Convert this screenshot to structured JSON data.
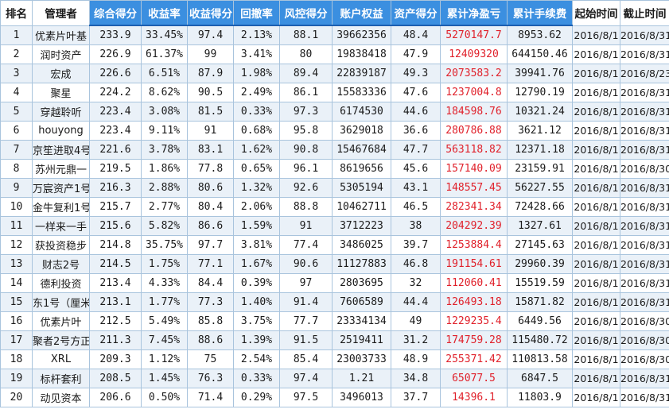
{
  "columns": [
    {
      "label": "排名",
      "sortable": false
    },
    {
      "label": "管理者",
      "sortable": false
    },
    {
      "label": "综合得分",
      "sortable": true
    },
    {
      "label": "收益率",
      "sortable": true
    },
    {
      "label": "收益得分",
      "sortable": true
    },
    {
      "label": "回撤率",
      "sortable": true
    },
    {
      "label": "风控得分",
      "sortable": true
    },
    {
      "label": "账户权益",
      "sortable": true
    },
    {
      "label": "资产得分",
      "sortable": true
    },
    {
      "label": "累计净盈亏",
      "sortable": true
    },
    {
      "label": "累计手续费",
      "sortable": true
    },
    {
      "label": "起始时间",
      "sortable": false
    },
    {
      "label": "截止时间",
      "sortable": false
    }
  ],
  "rows": [
    [
      "1",
      "优素片叶基",
      "233.9",
      "33.45%",
      "97.4",
      "2.13%",
      "88.1",
      "39662356",
      "48.4",
      "5270147.7",
      "8953.62",
      "2016/8/1",
      "2016/8/31"
    ],
    [
      "2",
      "润时资产",
      "226.9",
      "61.37%",
      "99",
      "3.41%",
      "80",
      "19838418",
      "47.9",
      "12409320",
      "644150.46",
      "2016/8/1",
      "2016/8/31"
    ],
    [
      "3",
      "宏成",
      "226.6",
      "6.51%",
      "87.9",
      "1.98%",
      "89.4",
      "22839187",
      "49.3",
      "2073583.2",
      "39941.76",
      "2016/8/1",
      "2016/8/23"
    ],
    [
      "4",
      "聚星",
      "224.2",
      "8.62%",
      "90.5",
      "2.49%",
      "86.1",
      "15583336",
      "47.6",
      "1237004.8",
      "12790.19",
      "2016/8/1",
      "2016/8/31"
    ],
    [
      "5",
      "穿越聆听",
      "223.4",
      "3.08%",
      "81.5",
      "0.33%",
      "97.3",
      "6174530",
      "44.6",
      "184598.76",
      "10321.24",
      "2016/8/1",
      "2016/8/31"
    ],
    [
      "6",
      "houyong",
      "223.4",
      "9.11%",
      "91",
      "0.68%",
      "95.8",
      "3629018",
      "36.6",
      "280786.88",
      "3621.12",
      "2016/8/1",
      "2016/8/31"
    ],
    [
      "7",
      "京笙进取4号",
      "221.6",
      "3.78%",
      "83.1",
      "1.62%",
      "90.8",
      "15467684",
      "47.7",
      "563118.82",
      "12371.18",
      "2016/8/1",
      "2016/8/31"
    ],
    [
      "8",
      "苏州元鼎一",
      "219.5",
      "1.86%",
      "77.8",
      "0.65%",
      "96.1",
      "8619656",
      "45.6",
      "157140.09",
      "23159.91",
      "2016/8/1",
      "2016/8/30"
    ],
    [
      "9",
      "万宸资产1号",
      "216.3",
      "2.88%",
      "80.6",
      "1.32%",
      "92.6",
      "5305194",
      "43.1",
      "148557.45",
      "56227.55",
      "2016/8/1",
      "2016/8/31"
    ],
    [
      "10",
      "金牛复利1号",
      "215.7",
      "2.77%",
      "80.4",
      "2.06%",
      "88.8",
      "10462711",
      "46.5",
      "282341.34",
      "72428.66",
      "2016/8/1",
      "2016/8/31"
    ],
    [
      "11",
      "一样来一手",
      "215.6",
      "5.82%",
      "86.6",
      "1.59%",
      "91",
      "3712223",
      "38",
      "204292.39",
      "1327.61",
      "2016/8/1",
      "2016/8/31"
    ],
    [
      "12",
      "获投资稳步",
      "214.8",
      "35.75%",
      "97.7",
      "3.81%",
      "77.4",
      "3486025",
      "39.7",
      "1253884.4",
      "27145.63",
      "2016/8/1",
      "2016/8/31"
    ],
    [
      "13",
      "财志2号",
      "214.5",
      "1.75%",
      "77.1",
      "1.67%",
      "90.6",
      "11127883",
      "46.8",
      "191154.61",
      "29960.39",
      "2016/8/1",
      "2016/8/31"
    ],
    [
      "14",
      "德利投资",
      "213.4",
      "4.33%",
      "84.4",
      "0.39%",
      "97",
      "2803695",
      "32",
      "112060.41",
      "15519.59",
      "2016/8/1",
      "2016/8/31"
    ],
    [
      "15",
      "东1号（厘米",
      "213.1",
      "1.77%",
      "77.3",
      "1.40%",
      "91.4",
      "7606589",
      "44.4",
      "126493.18",
      "15871.82",
      "2016/8/1",
      "2016/8/31"
    ],
    [
      "16",
      "优素片叶",
      "212.5",
      "5.49%",
      "85.8",
      "3.75%",
      "77.7",
      "23334134",
      "49",
      "1229235.4",
      "6449.56",
      "2016/8/1",
      "2016/8/30"
    ],
    [
      "17",
      "聚者2号方正",
      "211.3",
      "7.45%",
      "88.6",
      "1.39%",
      "91.5",
      "2519411",
      "31.2",
      "174759.28",
      "115480.72",
      "2016/8/1",
      "2016/8/30"
    ],
    [
      "18",
      "XRL",
      "209.3",
      "1.12%",
      "75",
      "2.54%",
      "85.4",
      "23003733",
      "48.9",
      "255371.42",
      "110813.58",
      "2016/8/1",
      "2016/8/30"
    ],
    [
      "19",
      "标杆套利",
      "208.5",
      "1.45%",
      "76.3",
      "0.33%",
      "97.4",
      "1.21",
      "34.8",
      "65077.5",
      "6847.5",
      "2016/8/1",
      "2016/8/31"
    ],
    [
      "20",
      "动见资本",
      "206.6",
      "0.50%",
      "71.4",
      "0.29%",
      "97.5",
      "3496013",
      "37.7",
      "14396.1",
      "11803.9",
      "2016/8/1",
      "2016/8/31"
    ]
  ],
  "colors": {
    "header_accent": "#3b8fe0",
    "header_underline": "#1c5fb0",
    "profit_text": "#e0202a",
    "stripe": "#eaf1f8",
    "grid": "#a9c4dd"
  }
}
